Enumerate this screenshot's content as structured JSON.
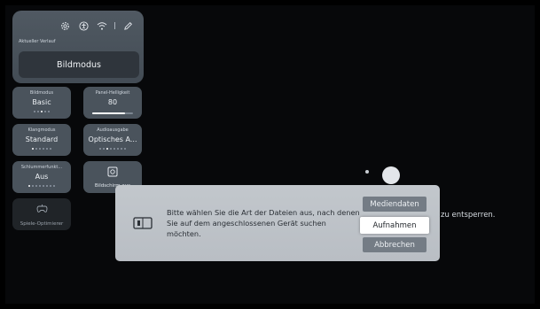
{
  "quick_settings": {
    "top_icons": [
      "gear-icon",
      "accessibility-icon",
      "wifi-icon",
      "edit-icon"
    ],
    "history_label": "Aktueller Verlauf",
    "history_button": "Bildmodus",
    "tiles": [
      {
        "label": "Bildmodus",
        "value": "Basic"
      },
      {
        "label": "Panel-Helligkeit",
        "value": "80",
        "level_percent": 80
      },
      {
        "label": "Klangmodus",
        "value": "Standard"
      },
      {
        "label": "Audioausgabe",
        "value": "Optisches A..."
      },
      {
        "label": "Schlummerfunkt...",
        "value": "Aus"
      },
      {
        "label": "Bildschirm aus",
        "icon": "screen-off-icon"
      },
      {
        "label": "Spiele-Optimierer",
        "icon": "gamepad-icon"
      }
    ]
  },
  "background_hint": "m zu entsperren.",
  "dialog": {
    "icon": "usb-device-icon",
    "message": "Bitte wählen Sie die Art der Dateien aus, nach denen Sie auf dem angeschlossenen Gerät suchen möchten.",
    "buttons": {
      "media": "Mediendaten",
      "recordings": "Aufnahmen",
      "cancel": "Abbrechen"
    }
  }
}
